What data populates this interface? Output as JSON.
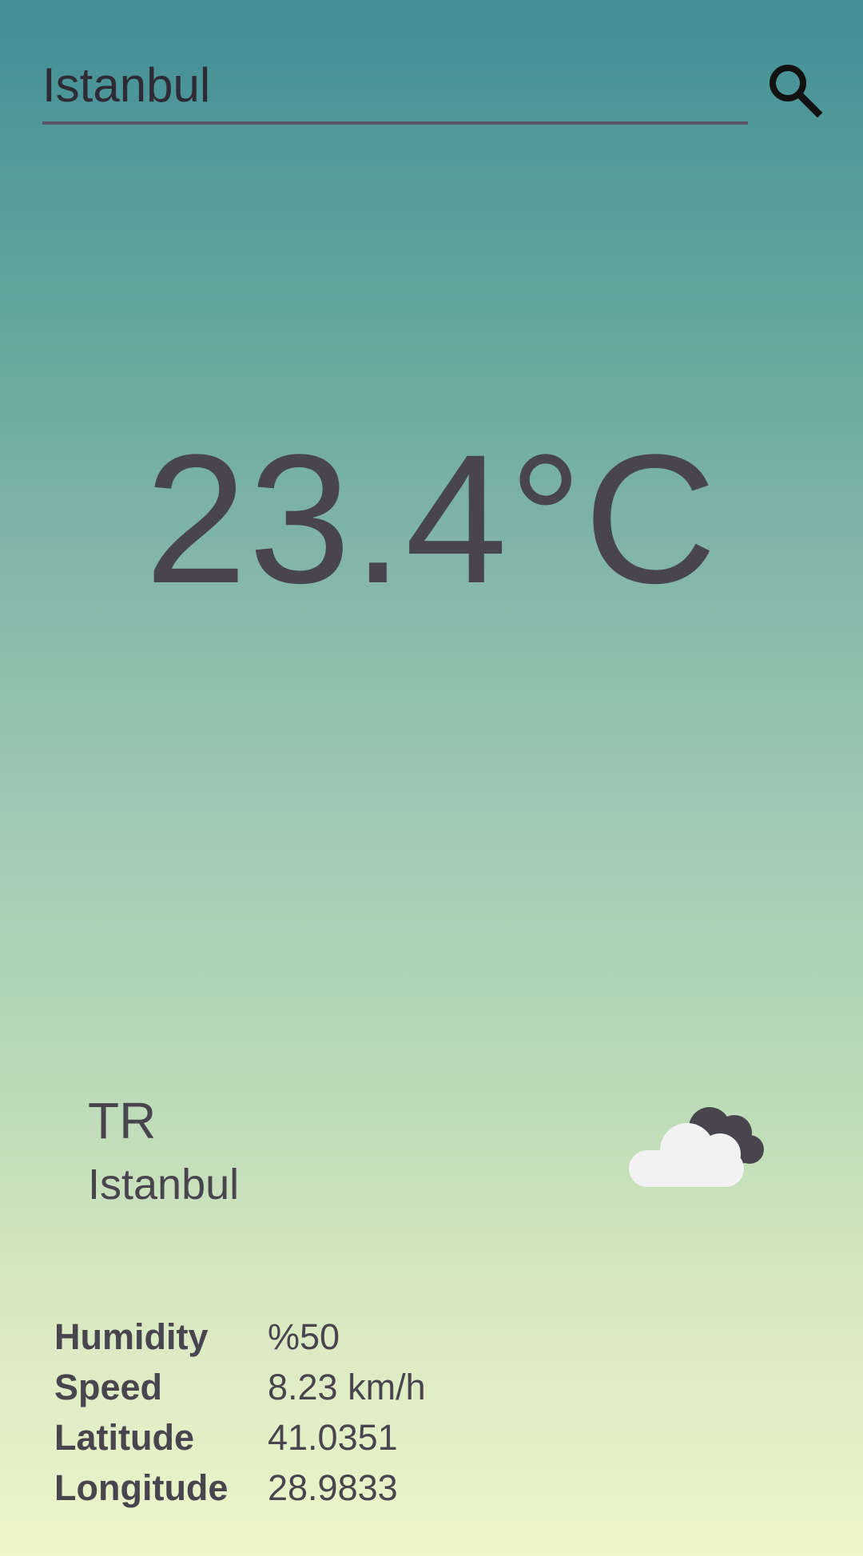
{
  "search": {
    "value": "Istanbul",
    "icon": "search-icon"
  },
  "weather": {
    "temperature": "23.4°C",
    "country": "TR",
    "city": "Istanbul",
    "icon": "partly-cloudy-icon"
  },
  "details": [
    {
      "label": "Humidity",
      "value": "%50"
    },
    {
      "label": "Speed",
      "value": "8.23 km/h"
    },
    {
      "label": "Latitude",
      "value": "41.0351"
    },
    {
      "label": "Longitude",
      "value": "28.9833"
    }
  ]
}
